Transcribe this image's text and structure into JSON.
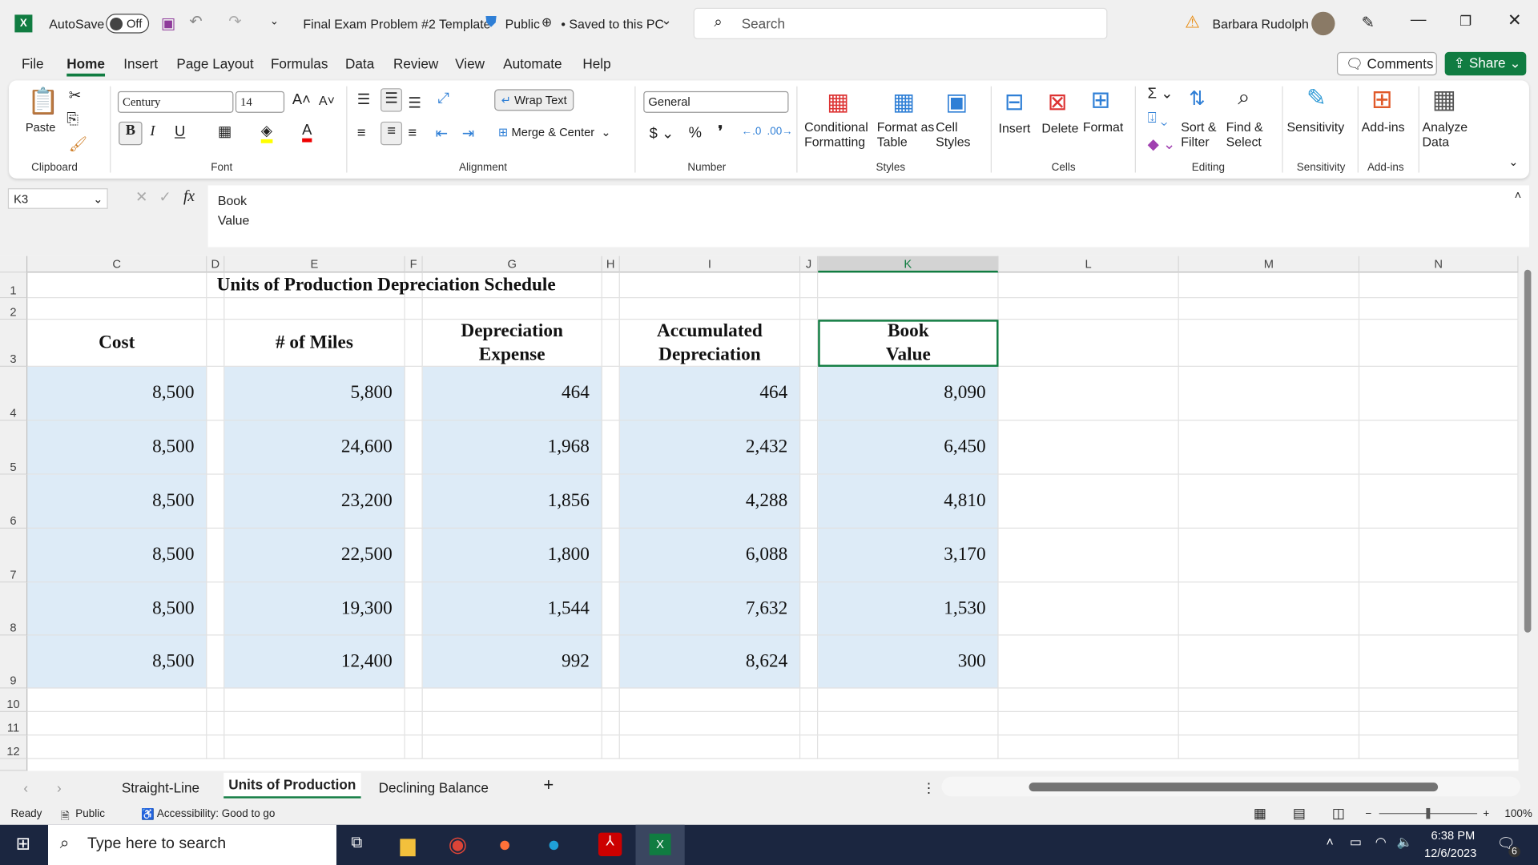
{
  "titlebar": {
    "autosave": "AutoSave",
    "toggle": "Off",
    "doc_title": "Final Exam Problem #2 Template",
    "sensitivity": "Public",
    "saved": "• Saved to this PC",
    "search_placeholder": "Search",
    "user": "Barbara Rudolph"
  },
  "menu": [
    "File",
    "Home",
    "Insert",
    "Page Layout",
    "Formulas",
    "Data",
    "Review",
    "View",
    "Automate",
    "Help"
  ],
  "comments": "Comments",
  "share": "Share",
  "ribbon": {
    "paste": "Paste",
    "font_name": "Century",
    "font_size": "14",
    "wrap_text": "Wrap Text",
    "merge_center": "Merge & Center",
    "number_format": "General",
    "conditional": "Conditional\nFormatting",
    "format_table": "Format as\nTable",
    "cell_styles": "Cell\nStyles",
    "insert": "Insert",
    "delete": "Delete",
    "format": "Format",
    "sort_filter": "Sort &\nFilter",
    "find_select": "Find &\nSelect",
    "sensitivity": "Sensitivity",
    "addins": "Add-ins",
    "analyze": "Analyze\nData",
    "groups": [
      "Clipboard",
      "Font",
      "Alignment",
      "Number",
      "Styles",
      "Cells",
      "Editing",
      "Sensitivity",
      "Add-ins"
    ]
  },
  "formula_bar": {
    "name_box": "K3",
    "fx": "fx",
    "content_line1": "Book",
    "content_line2": "Value"
  },
  "columns": [
    "C",
    "D",
    "E",
    "F",
    "G",
    "H",
    "I",
    "J",
    "K",
    "L",
    "M",
    "N"
  ],
  "rows": [
    "1",
    "2",
    "3",
    "4",
    "5",
    "6",
    "7",
    "8",
    "9",
    "10",
    "11",
    "12"
  ],
  "sheet": {
    "title": "Units of Production Depreciation Schedule",
    "headers": {
      "C": "Cost",
      "E": "# of Miles",
      "G": "Depreciation\nExpense",
      "I": "Accumulated\nDepreciation",
      "K": "Book\nValue"
    },
    "data": [
      {
        "C": "8,500",
        "E": "5,800",
        "G": "464",
        "I": "464",
        "K": "8,090"
      },
      {
        "C": "8,500",
        "E": "24,600",
        "G": "1,968",
        "I": "2,432",
        "K": "6,450"
      },
      {
        "C": "8,500",
        "E": "23,200",
        "G": "1,856",
        "I": "4,288",
        "K": "4,810"
      },
      {
        "C": "8,500",
        "E": "22,500",
        "G": "1,800",
        "I": "6,088",
        "K": "3,170"
      },
      {
        "C": "8,500",
        "E": "19,300",
        "G": "1,544",
        "I": "7,632",
        "K": "1,530"
      },
      {
        "C": "8,500",
        "E": "12,400",
        "G": "992",
        "I": "8,624",
        "K": "300"
      }
    ]
  },
  "tabs": [
    "Straight-Line",
    "Units of Production",
    "Declining Balance"
  ],
  "active_tab": 1,
  "status": {
    "ready": "Ready",
    "public": "Public",
    "accessibility": "Accessibility: Good to go",
    "zoom": "100%",
    "zoom_level": 100
  },
  "taskbar": {
    "search_placeholder": "Type here to search",
    "time": "6:38 PM",
    "date": "12/6/2023",
    "notifications": "6"
  }
}
